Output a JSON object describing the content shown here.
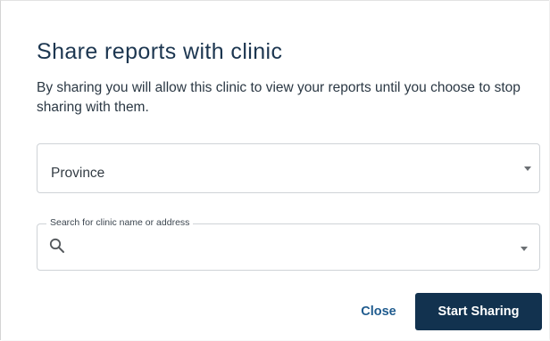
{
  "dialog": {
    "title": "Share reports with clinic",
    "description": "By sharing you will allow this clinic to view your reports until you choose to stop sharing with them."
  },
  "province_select": {
    "value": "Province",
    "icon": "chevron-down-icon"
  },
  "clinic_search": {
    "label": "Search for clinic name or address",
    "value": "",
    "icon": "search-icon",
    "dropdown_icon": "chevron-down-icon"
  },
  "actions": {
    "close_label": "Close",
    "start_label": "Start Sharing"
  },
  "colors": {
    "title": "#1c3650",
    "link": "#1f5b8e",
    "primary_button": "#12324f",
    "border": "#cfd3d7"
  }
}
